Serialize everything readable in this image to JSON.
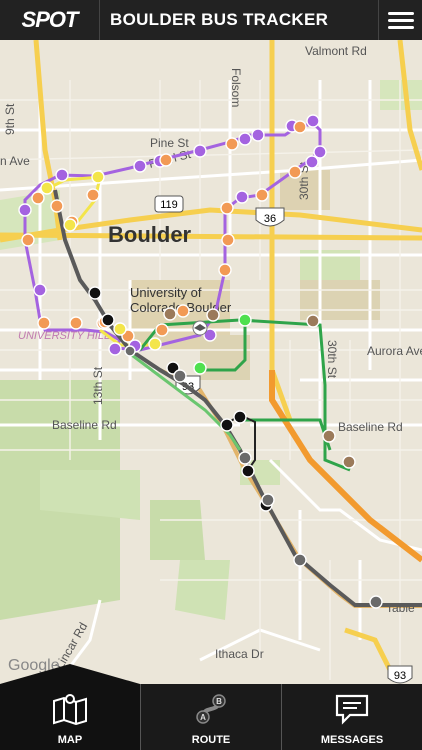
{
  "header": {
    "logo": "SPOT",
    "title": "BOULDER BUS TRACKER"
  },
  "map": {
    "city_label": "Boulder",
    "streets": [
      "Valmont Rd",
      "Pine St",
      "Pearl St",
      "30th St",
      "9th St",
      "13th St",
      "Baseline Rd",
      "Baseline Rd",
      "Aurora Ave",
      "Ithaca Dr",
      "Table",
      "Folsom",
      "n Ave",
      "University of",
      "Colorado Boulder",
      "UNIVERSITY HILL",
      "Lincar Rd",
      "30th St"
    ],
    "highway_shields": [
      "119",
      "36",
      "93",
      "93"
    ],
    "attribution": "Google",
    "route_colors": {
      "purple": "#a463e0",
      "green": "#2fa44a",
      "gray": "#5a5a5a",
      "orange": "#f29a2e"
    }
  },
  "nav": {
    "items": [
      {
        "label": "MAP",
        "icon": "map-icon"
      },
      {
        "label": "ROUTE",
        "icon": "route-icon"
      },
      {
        "label": "MESSAGES",
        "icon": "messages-icon"
      }
    ]
  }
}
